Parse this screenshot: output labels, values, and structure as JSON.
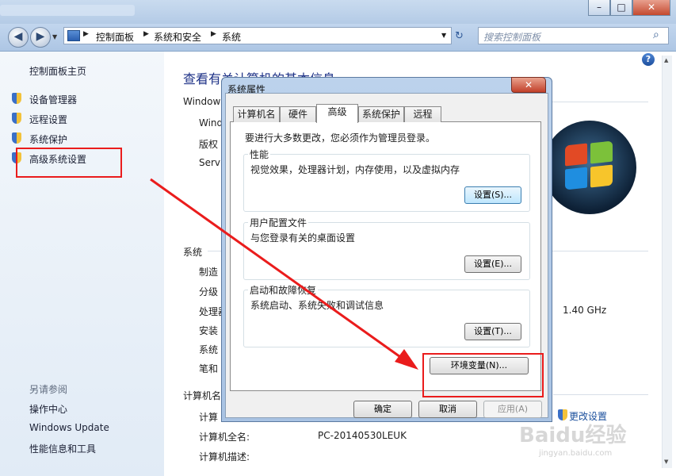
{
  "window": {
    "caption_buttons": [
      "–",
      "□",
      "✕"
    ],
    "address": {
      "breadcrumb": [
        "控制面板",
        "系统和安全",
        "系统"
      ]
    },
    "search_placeholder": "搜索控制面板",
    "help_glyph": "?"
  },
  "sidebar": {
    "home": "控制面板主页",
    "items": [
      "设备管理器",
      "远程设置",
      "系统保护",
      "高级系统设置"
    ],
    "see_also_title": "另请参阅",
    "see_also": [
      "操作中心",
      "Windows Update",
      "性能信息和工具"
    ]
  },
  "main": {
    "heading": "查看有关计算机的基本信息",
    "windows_section": "Windows",
    "windows_items": [
      "Wind",
      "版权",
      "Servi"
    ],
    "system_section": "系统",
    "system_items": [
      "制造",
      "分级",
      "处理器",
      "安装",
      "系统",
      "笔和"
    ],
    "processor_speed": "1.40 GHz",
    "computer_section": "计算机名",
    "computer_rows": [
      {
        "label": "计算",
        "value": ""
      },
      {
        "label": "计算机全名:",
        "value": "PC-20140530LEUK"
      },
      {
        "label": "计算机描述:",
        "value": ""
      }
    ],
    "change_settings": "更改设置"
  },
  "dialog": {
    "title": "系统属性",
    "close_glyph": "✕",
    "tabs": [
      "计算机名",
      "硬件",
      "高级",
      "系统保护",
      "远程"
    ],
    "active_tab": "高级",
    "intro": "要进行大多数更改，您必须作为管理员登录。",
    "groups": [
      {
        "title": "性能",
        "desc": "视觉效果，处理器计划，内存使用，以及虚拟内存",
        "button": "设置(S)..."
      },
      {
        "title": "用户配置文件",
        "desc": "与您登录有关的桌面设置",
        "button": "设置(E)..."
      },
      {
        "title": "启动和故障恢复",
        "desc": "系统启动、系统失败和调试信息",
        "button": "设置(T)..."
      }
    ],
    "env_button": "环境变量(N)...",
    "ok": "确定",
    "cancel": "取消",
    "apply": "应用(A)"
  },
  "watermark": {
    "brand": "Baidu经验",
    "url": "jingyan.baidu.com"
  },
  "colors": {
    "annotation_red": "#ea1c1c",
    "sidebar_bg": "#e9f0f8",
    "heading_blue": "#1e3287"
  }
}
